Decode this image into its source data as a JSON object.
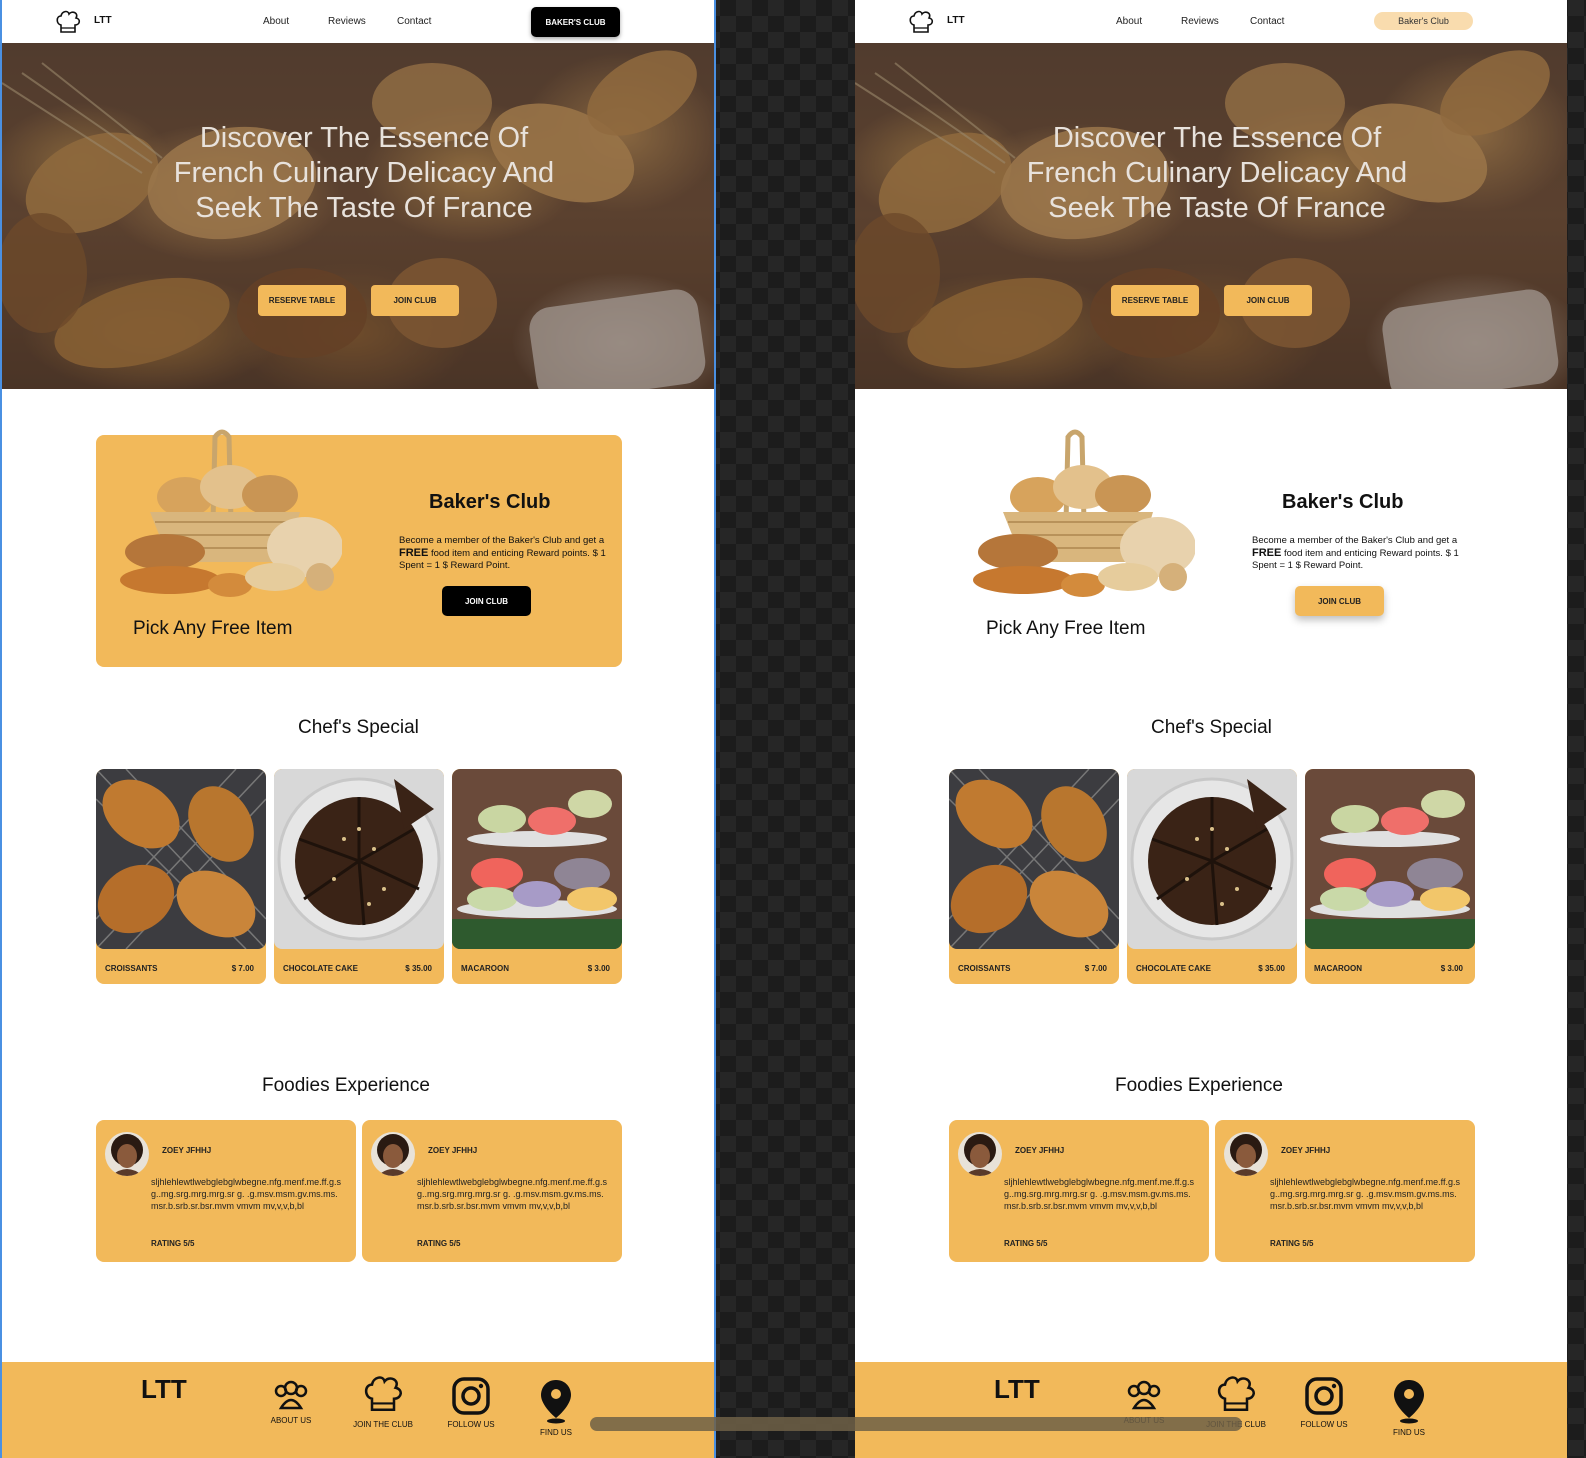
{
  "nav": {
    "logo": "LTT",
    "links": [
      "About",
      "Reviews",
      "Contact"
    ],
    "club_label_left": "BAKER'S CLUB",
    "club_label_right": "Baker's Club"
  },
  "hero": {
    "title": "Discover The Essence Of French Culinary Delicacy And Seek The Taste Of France",
    "reserve_label": "RESERVE TABLE",
    "join_label": "JOIN CLUB"
  },
  "club": {
    "title": "Baker's Club",
    "desc_before": "Become a member of the Baker's Club and get a ",
    "desc_bold": "FREE",
    "desc_after": " food item and enticing Reward points. $ 1 Spent = 1 $ Reward Point.",
    "pick": "Pick Any Free Item",
    "button": "JOIN CLUB"
  },
  "special": {
    "title": "Chef's Special",
    "items": [
      {
        "name": "CROISSANTS",
        "price": "$ 7.00"
      },
      {
        "name": "CHOCOLATE CAKE",
        "price": "$ 35.00"
      },
      {
        "name": "MACAROON",
        "price": "$ 3.00"
      }
    ]
  },
  "foodies": {
    "title": "Foodies Experience",
    "reviews": [
      {
        "name": "ZOEY JFHHJ",
        "text": "sljhlehlewtlwebglebglwbegne.nfg.menf.me.ff.g.s g..mg.srg.mrg.mrg.sr g. .g.msv.msm.gv.ms.ms.msr.b.srb.sr.bsr.mvm vmvm mv,v,v,b,bl",
        "rating": "RATING  5/5"
      },
      {
        "name": "ZOEY JFHHJ",
        "text": "sljhlehlewtlwebglebglwbegne.nfg.menf.me.ff.g.s g..mg.srg.mrg.mrg.sr g. .g.msv.msm.gv.ms.ms.msr.b.srb.sr.bsr.mvm vmvm mv,v,v,b,bl",
        "rating": "RATING  5/5"
      }
    ]
  },
  "footer": {
    "logo": "LTT",
    "items": [
      {
        "label": "ABOUT US",
        "icon": "people-icon"
      },
      {
        "label": "JOIN THE CLUB",
        "icon": "chef-hat-icon"
      },
      {
        "label": "FOLLOW US",
        "icon": "instagram-icon"
      },
      {
        "label": "FIND US",
        "icon": "location-pin-icon"
      }
    ]
  },
  "colors": {
    "accent": "#f2b95a",
    "dark": "#000000",
    "accent_light": "#f9dcae"
  }
}
